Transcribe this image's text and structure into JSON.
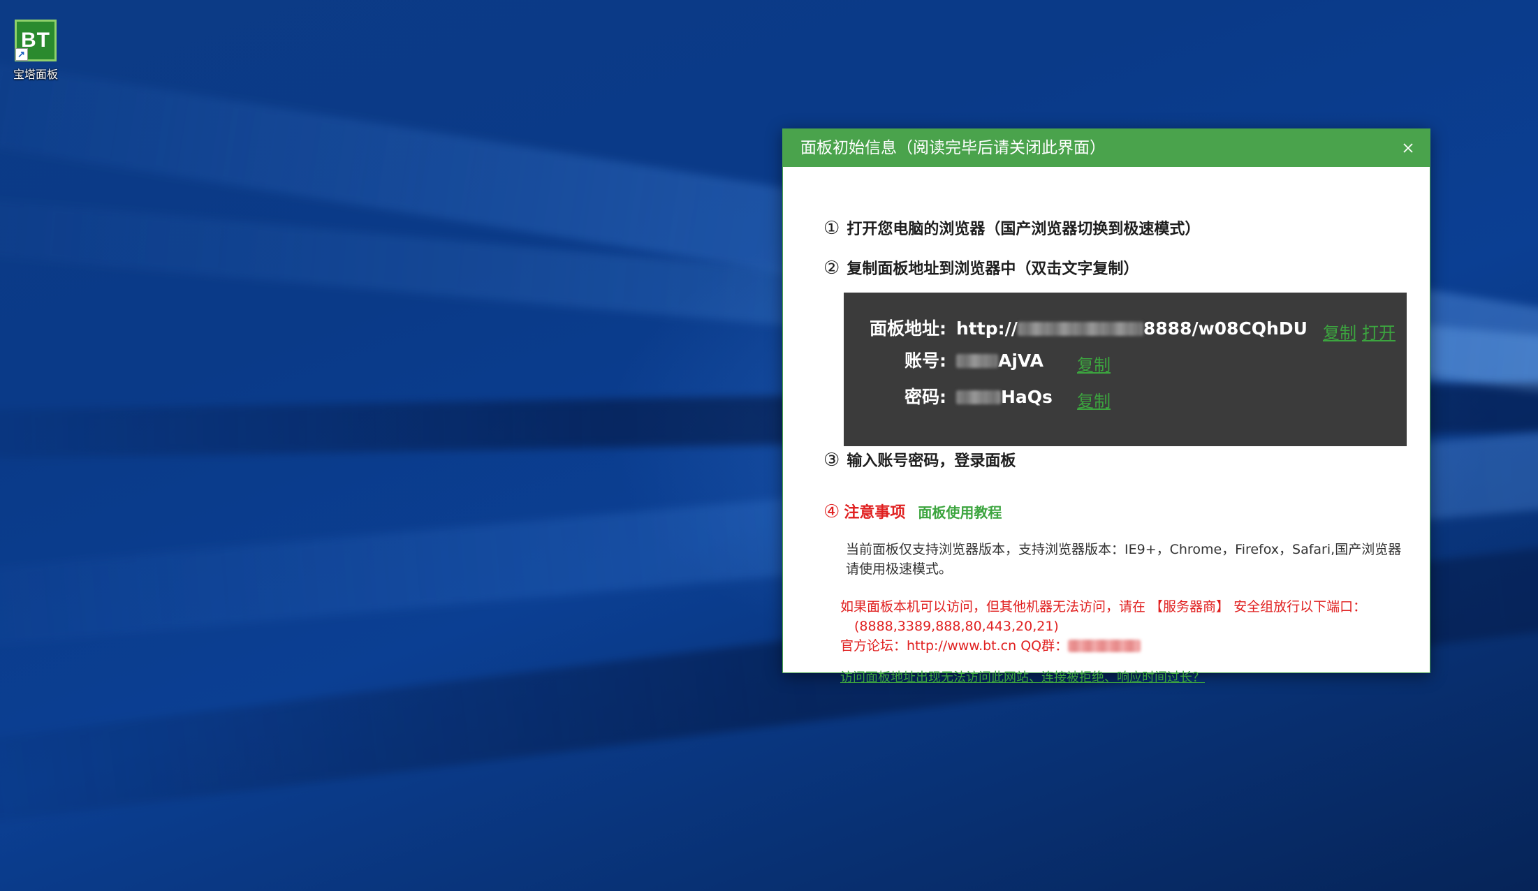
{
  "desktop": {
    "icon": {
      "logo_text": "BT",
      "label": "宝塔面板",
      "shortcut_glyph": "↗"
    }
  },
  "dialog": {
    "title": "面板初始信息（阅读完毕后请关闭此界面）",
    "close_glyph": "×",
    "steps": {
      "step1": {
        "num": "①",
        "text": "打开您电脑的浏览器（国产浏览器切换到极速模式）"
      },
      "step2": {
        "num": "②",
        "text": "复制面板地址到浏览器中（双击文字复制）"
      },
      "step3": {
        "num": "③",
        "text": "输入账号密码，登录面板"
      }
    },
    "info": {
      "address_label": "面板地址:",
      "address_prefix": "http://",
      "address_suffix": "8888/w08CQhDU",
      "account_label": "账号:",
      "account_suffix": "AjVA",
      "password_label": "密码:",
      "password_suffix": "HaQs",
      "copy_label": "复制",
      "open_label": "打开"
    },
    "notes": {
      "num": "④",
      "title": "注意事项",
      "tutorial_link": "面板使用教程",
      "browser_note": "当前面板仅支持浏览器版本，支持浏览器版本：IE9+，Chrome，Firefox，Safari,国产浏览器请使用极速模式。",
      "port_note_line1": "如果面板本机可以访问，但其他机器无法访问，请在 【服务器商】 安全组放行以下端口：",
      "port_note_line2": "(8888,3389,888,80,443,20,21)",
      "forum_text": "官方论坛：http://www.bt.cn  QQ群：",
      "trouble_link": "访问面板地址出现无法访问此网站、连接被拒绝、响应时间过长？"
    }
  },
  "colors": {
    "accent_green": "#4aa34c",
    "link_green": "#3ca53f",
    "warning_red": "#e02020",
    "info_box_bg": "#3b3b3b"
  }
}
